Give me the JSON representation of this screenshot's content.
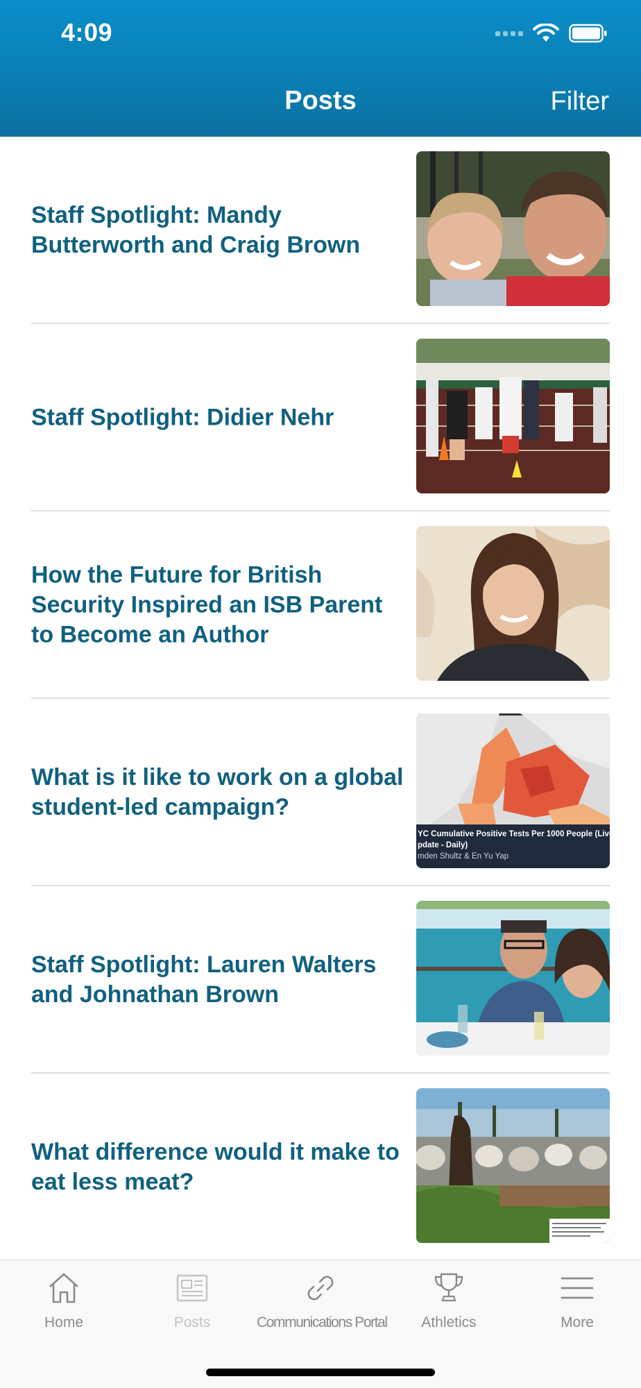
{
  "status_bar": {
    "time": "4:09",
    "icons": [
      "signal-dots-icon",
      "wifi-icon",
      "battery-icon"
    ]
  },
  "header": {
    "title": "Posts",
    "filter_label": "Filter",
    "gradient_colors": [
      "#0a8ec9",
      "#0b6f9f"
    ]
  },
  "posts": [
    {
      "title": "Staff Spotlight: Mandy Butterworth and Craig Brown",
      "thumbnail": "selfie-photo"
    },
    {
      "title": "Staff Spotlight: Didier Nehr",
      "thumbnail": "children-track-photo"
    },
    {
      "title": "How the Future for British Security Inspired an ISB Parent to Become an Author",
      "thumbnail": "portrait-photo"
    },
    {
      "title": "What is it like to work on a global student-led campaign?",
      "thumbnail": "nyc-map-image",
      "thumbnail_caption_line1": "YC Cumulative Positive Tests Per 1000 People (Live",
      "thumbnail_caption_line2": "pdate - Daily)",
      "thumbnail_caption_line3": "mden Shultz & En Yu Yap"
    },
    {
      "title": "Staff Spotlight: Lauren Walters and Johnathan Brown",
      "thumbnail": "couple-boat-photo"
    },
    {
      "title": "What difference would it make to eat less meat?",
      "thumbnail": "cattle-field-photo"
    }
  ],
  "tabbar": {
    "tabs": [
      {
        "label": "Home",
        "icon": "house-icon",
        "active": false
      },
      {
        "label": "Posts",
        "icon": "newspaper-icon",
        "active": true
      },
      {
        "label": "Communications Portal",
        "icon": "link-icon",
        "active": false
      },
      {
        "label": "Athletics",
        "icon": "trophy-icon",
        "active": false
      },
      {
        "label": "More",
        "icon": "menu-icon",
        "active": false
      }
    ]
  },
  "colors": {
    "title_text": "#10607f",
    "tab_inactive": "#8a8a8a",
    "tab_active": "#c3c3c3"
  }
}
